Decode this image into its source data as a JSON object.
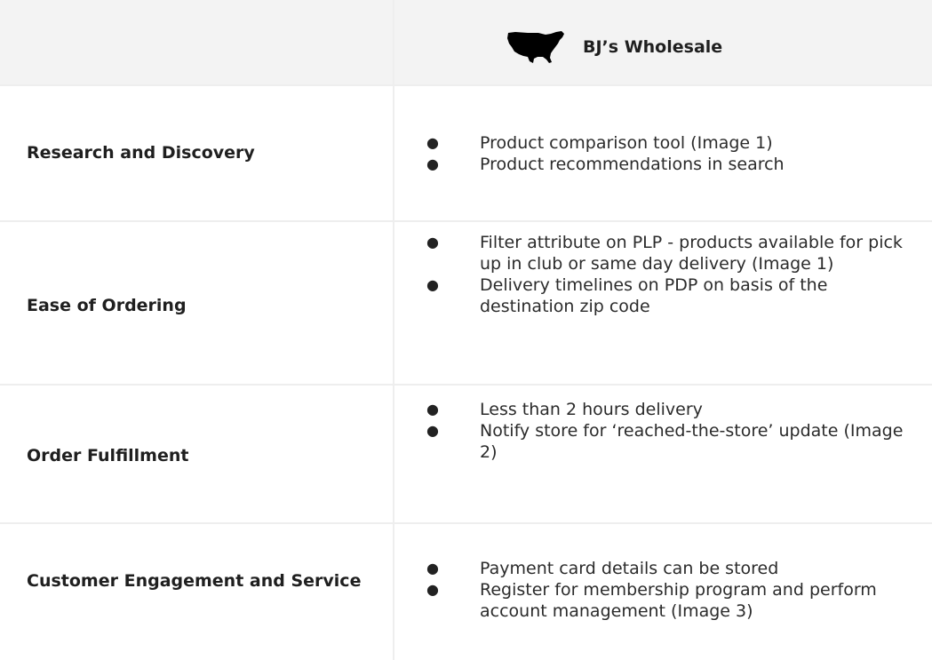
{
  "header": {
    "brand_icon": "usa-map-icon",
    "brand_name": "BJ’s Wholesale"
  },
  "rows": [
    {
      "label": "Research and Discovery",
      "bullets": [
        "Product comparison tool (Image 1)",
        "Product recommendations in search"
      ]
    },
    {
      "label": "Ease of Ordering",
      "bullets": [
        "Filter attribute on PLP - products available for pick up in club or same day delivery (Image 1)",
        "Delivery timelines on PDP on basis of the destination zip code"
      ]
    },
    {
      "label": "Order Fulfillment",
      "bullets": [
        "Less than 2 hours delivery",
        "Notify store for ‘reached-the-store’ update (Image 2)"
      ]
    },
    {
      "label": "Customer Engagement and Service",
      "bullets": [
        "Payment card details can be stored",
        "Register for membership program and perform account management (Image 3)"
      ]
    }
  ],
  "bullet_glyph": "●"
}
